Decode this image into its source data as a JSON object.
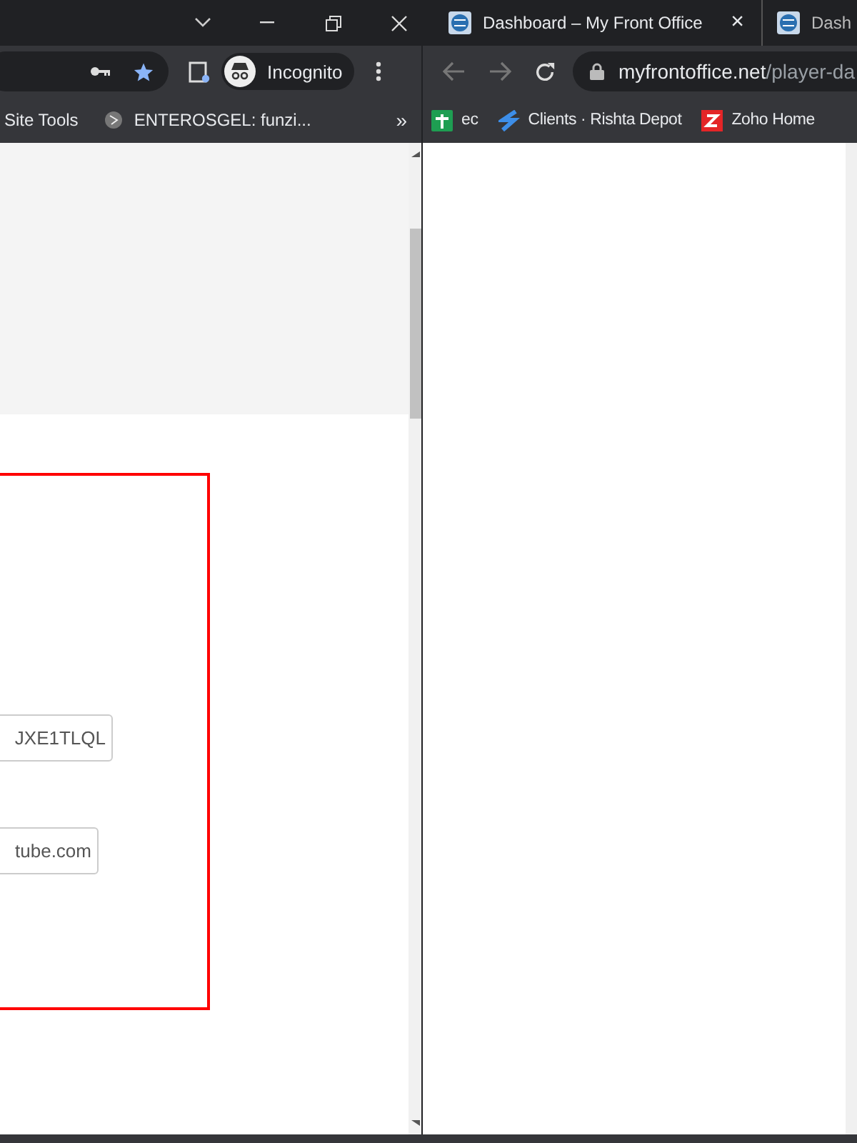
{
  "left_window": {
    "toolbar": {
      "profile_label": "Incognito"
    },
    "bookmarks": [
      {
        "label": "Site Tools",
        "kind": "plain"
      },
      {
        "label": "ENTEROSGEL: funzi...",
        "kind": "icon"
      }
    ],
    "bookmarks_overflow": "»",
    "fields": [
      {
        "value": "JXE1TLQL"
      },
      {
        "value": "tube.com"
      }
    ]
  },
  "right_window": {
    "tabs": [
      {
        "title": "Dashboard – My Front Office",
        "selected": true
      },
      {
        "title": "Dash",
        "selected": false
      }
    ],
    "tab_close": "×",
    "address": {
      "host": "myfrontoffice.net",
      "path": "/player-da"
    },
    "bookmarks": [
      {
        "label": "ec",
        "kind": "green"
      },
      {
        "label": "Clients · Rishta Depot",
        "kind": "blue"
      },
      {
        "label": "Zoho Home",
        "kind": "red"
      }
    ]
  }
}
